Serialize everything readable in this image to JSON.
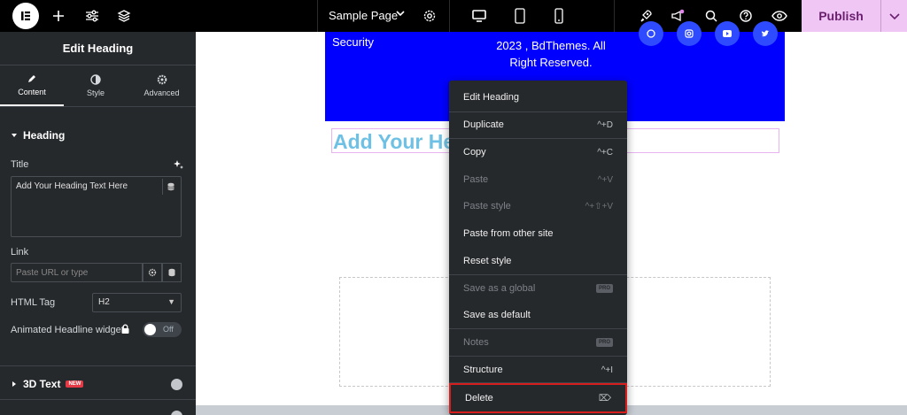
{
  "topbar": {
    "page_name": "Sample Page",
    "publish_label": "Publish",
    "icons": [
      "elementor-logo-icon",
      "plus-icon",
      "sliders-icon",
      "layers-icon",
      "chevron-down-icon",
      "gear-icon",
      "desktop-icon",
      "tablet-icon",
      "mobile-icon",
      "rocket-icon",
      "megaphone-icon",
      "search-icon",
      "help-icon",
      "eye-icon"
    ]
  },
  "sidebar": {
    "title": "Edit Heading",
    "tabs": [
      {
        "label": "Content",
        "icon": "pencil-icon",
        "active": true
      },
      {
        "label": "Style",
        "icon": "half-circle-icon",
        "active": false
      },
      {
        "label": "Advanced",
        "icon": "gear-icon",
        "active": false
      }
    ],
    "heading_section": "Heading",
    "title_label": "Title",
    "title_value": "Add Your Heading Text Here",
    "link_label": "Link",
    "link_placeholder": "Paste URL or type",
    "html_tag_label": "HTML Tag",
    "html_tag_value": "H2",
    "animated_label": "Animated Headline widget",
    "toggle_label": "Off",
    "section_3d": "3D Text",
    "new_badge": "NEW"
  },
  "canvas": {
    "security_text": "Security",
    "copyright_text": "2023 , BdThemes. All Right Reserved.",
    "heading_text": "Add Your He"
  },
  "context_menu": {
    "items": [
      {
        "label": "Edit Heading",
        "shortcut": "",
        "disabled": false
      },
      {
        "label": "Duplicate",
        "shortcut": "^+D",
        "disabled": false
      },
      {
        "label": "Copy",
        "shortcut": "^+C",
        "disabled": false
      },
      {
        "label": "Paste",
        "shortcut": "^+V",
        "disabled": true
      },
      {
        "label": "Paste style",
        "shortcut": "^+⇧+V",
        "disabled": true
      },
      {
        "label": "Paste from other site",
        "shortcut": "",
        "disabled": false
      },
      {
        "label": "Reset style",
        "shortcut": "",
        "disabled": false
      },
      {
        "label": "Save as a global",
        "shortcut": "",
        "badge": "PRO",
        "disabled": true
      },
      {
        "label": "Save as default",
        "shortcut": "",
        "disabled": false
      },
      {
        "label": "Notes",
        "shortcut": "",
        "badge": "PRO",
        "disabled": true
      },
      {
        "label": "Structure",
        "shortcut": "^+I",
        "disabled": false
      },
      {
        "label": "Delete",
        "shortcut": "⌦",
        "disabled": false
      }
    ]
  },
  "colors": {
    "accent": "#f0c6f5",
    "panel": "#26292c",
    "footer_blue": "#0000ff",
    "heading": "#6ec1e4",
    "delete_highlight": "#d71e1e"
  }
}
